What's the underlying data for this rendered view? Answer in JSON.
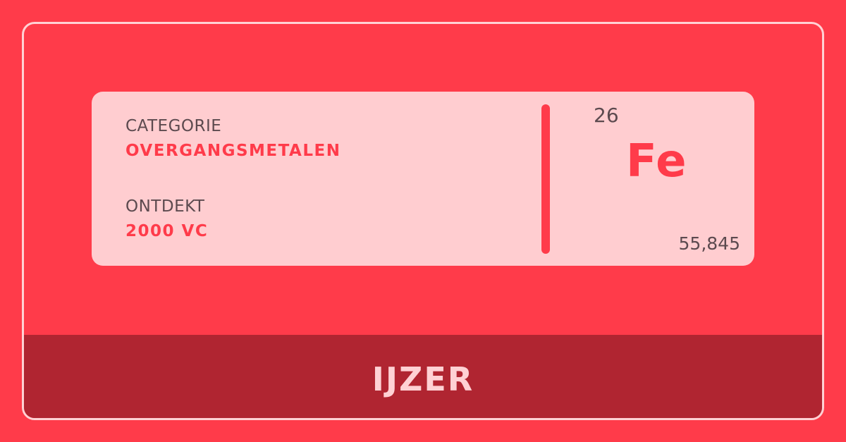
{
  "element": {
    "category_label": "CATEGORIE",
    "category_value": "OVERGANGSMETALEN",
    "discovered_label": "ONTDEKT",
    "discovered_value": "2000 VC",
    "atomic_number": "26",
    "symbol": "Fe",
    "atomic_mass": "55,845",
    "name": "IJZER"
  },
  "colors": {
    "background": "#ff3b4a",
    "card": "#ffcdd0",
    "footer": "#b02531",
    "accent": "#ff3b4a",
    "muted_text": "#5c4a4f",
    "light_text": "#ffd1d4"
  }
}
